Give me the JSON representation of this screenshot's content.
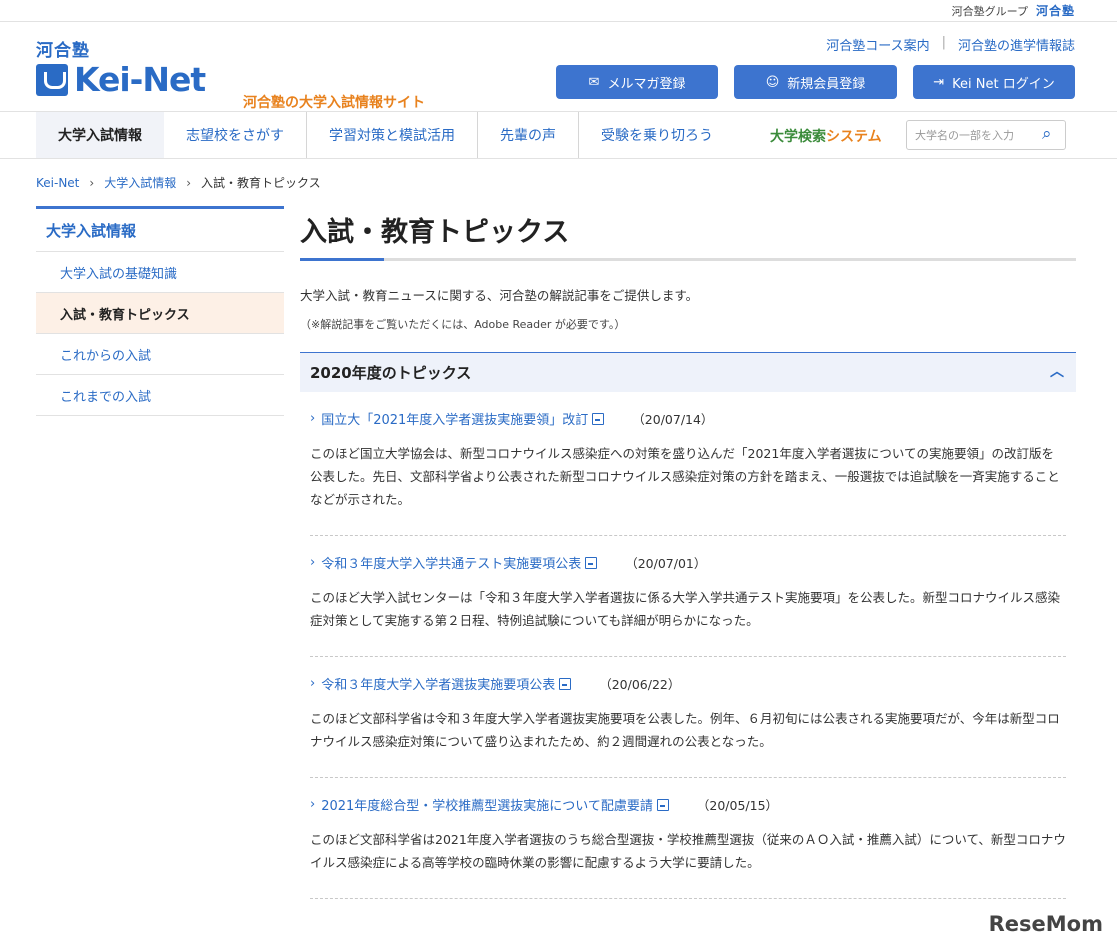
{
  "topstrip": {
    "group_label": "河合塾グループ",
    "brand": "河合塾"
  },
  "header": {
    "logo_small": "河合塾",
    "logo_wordmark": "Kei-Net",
    "tagline": "河合塾の大学入試情報サイト",
    "links": [
      "河合塾コース案内",
      "河合塾の進学情報誌"
    ],
    "buttons": [
      {
        "label": "メルマガ登録",
        "icon": "mail-icon"
      },
      {
        "label": "新規会員登録",
        "icon": "user-icon"
      },
      {
        "label": "Kei Net ログイン",
        "icon": "login-icon"
      }
    ]
  },
  "gnav": {
    "items": [
      "大学入試情報",
      "志望校をさがす",
      "学習対策と模試活用",
      "先輩の声",
      "受験を乗り切ろう"
    ],
    "system_label_a": "大学検索",
    "system_label_b": "システム",
    "search_placeholder": "大学名の一部を入力"
  },
  "breadcrumb": [
    "Kei-Net",
    "大学入試情報",
    "入試・教育トピックス"
  ],
  "sidebar": {
    "heading": "大学入試情報",
    "items": [
      "大学入試の基礎知識",
      "入試・教育トピックス",
      "これからの入試",
      "これまでの入試"
    ]
  },
  "main": {
    "title": "入試・教育トピックス",
    "intro": "大学入試・教育ニュースに関する、河合塾の解説記事をご提供します。",
    "note": "（※解説記事をご覧いただくには、Adobe Reader が必要です。）",
    "section_title": "2020年度のトピックス",
    "topics": [
      {
        "title": "国立大「2021年度入学者選抜実施要領」改訂",
        "date": "（20/07/14）",
        "body": "このほど国立大学協会は、新型コロナウイルス感染症への対策を盛り込んだ「2021年度入学者選抜についての実施要領」の改訂版を公表した。先日、文部科学省より公表された新型コロナウイルス感染症対策の方針を踏まえ、一般選抜では追試験を一斉実施することなどが示された。"
      },
      {
        "title": "令和３年度大学入学共通テスト実施要項公表",
        "date": "（20/07/01）",
        "body": "このほど大学入試センターは「令和３年度大学入学者選抜に係る大学入学共通テスト実施要項」を公表した。新型コロナウイルス感染症対策として実施する第２日程、特例追試験についても詳細が明らかになった。"
      },
      {
        "title": "令和３年度大学入学者選抜実施要項公表",
        "date": "（20/06/22）",
        "body": "このほど文部科学省は令和３年度大学入学者選抜実施要項を公表した。例年、６月初旬には公表される実施要項だが、今年は新型コロナウイルス感染症対策について盛り込まれたため、約２週間遅れの公表となった。"
      },
      {
        "title": "2021年度総合型・学校推薦型選抜実施について配慮要請",
        "date": "（20/05/15）",
        "body": "このほど文部科学省は2021年度入学者選抜のうち総合型選抜・学校推薦型選抜（従来のＡＯ入試・推薦入試）について、新型コロナウイルス感染症による高等学校の臨時休業の影響に配慮するよう大学に要請した。"
      }
    ]
  },
  "watermark": "ReseMom",
  "colors": {
    "primary": "#3d74cf",
    "accent": "#e8821e",
    "active_bg": "#fdf0e6"
  }
}
